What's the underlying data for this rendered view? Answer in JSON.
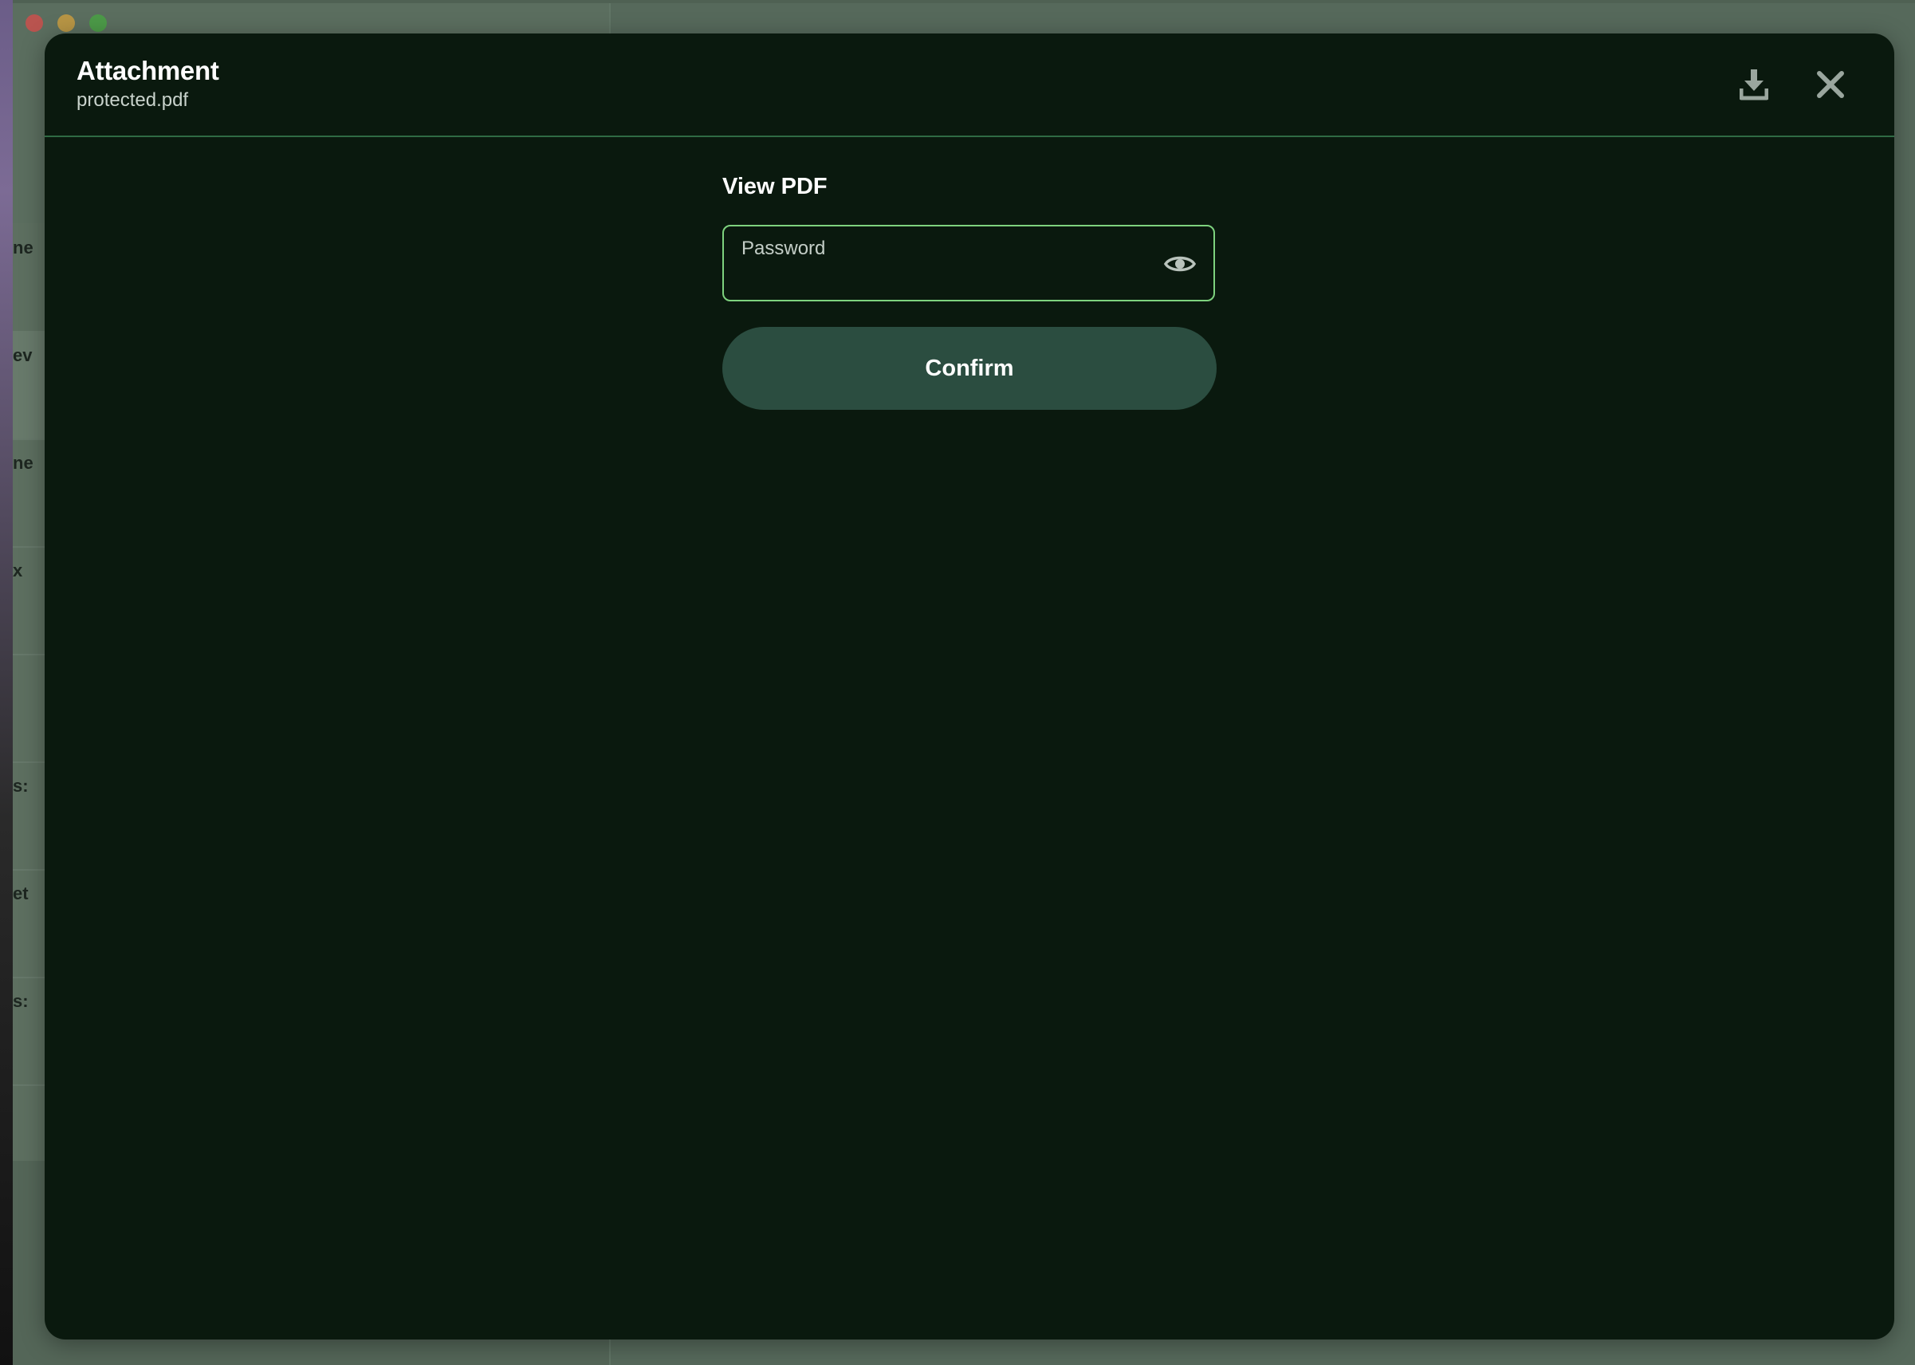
{
  "modal": {
    "title": "Attachment",
    "filename": "protected.pdf",
    "download_icon": "download-icon",
    "close_icon": "close-icon"
  },
  "form": {
    "heading": "View PDF",
    "password_label": "Password",
    "password_value": "",
    "eye_icon": "eye-icon",
    "confirm_label": "Confirm"
  },
  "colors": {
    "modal_bg": "#0a190e",
    "accent_border": "#7ed27e",
    "button_bg": "#2b4d40",
    "divider": "#2f6a44"
  },
  "background_list_fragments": [
    "ne",
    "ev",
    "ne",
    "x",
    "",
    "s:",
    "et",
    "s:"
  ]
}
